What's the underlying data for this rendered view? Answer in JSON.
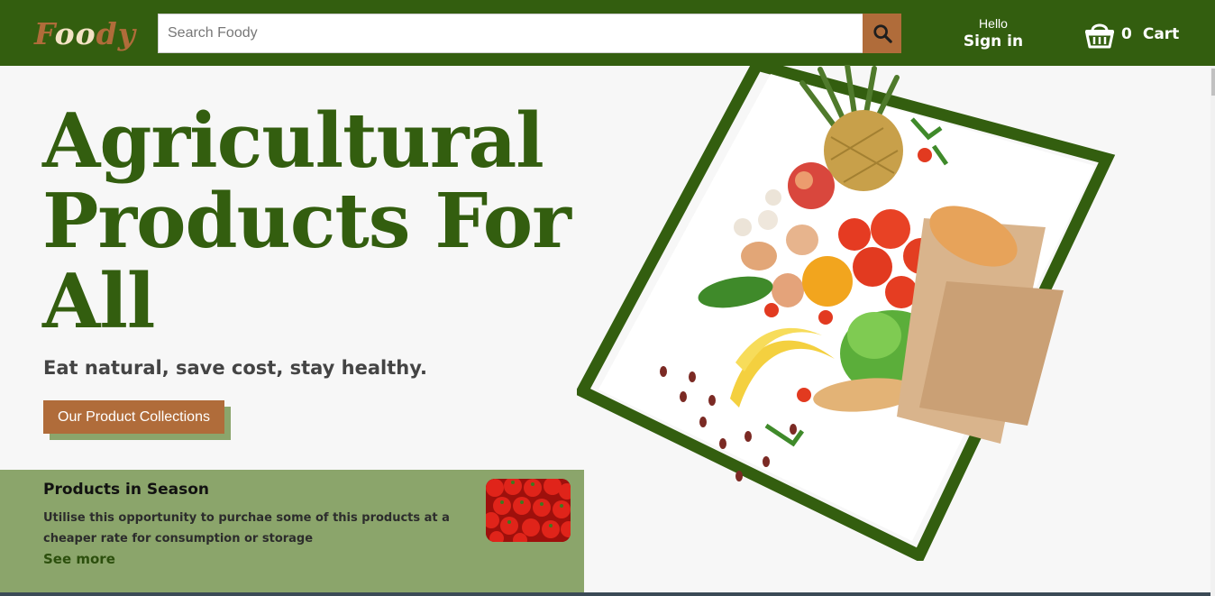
{
  "header": {
    "logo": {
      "part1": "F",
      "part2": "oo",
      "part3": "dy"
    },
    "search_placeholder": "Search Foody",
    "signin_greeting": "Hello",
    "signin_label": "Sign in",
    "cart_count": "0",
    "cart_label": "Cart"
  },
  "hero": {
    "title_line1": "Agricultural",
    "title_line2": "Products For",
    "title_line3": "All",
    "tagline": "Eat natural, save cost, stay healthy.",
    "cta_label": "Our Product Collections"
  },
  "season": {
    "title": "Products in Season",
    "text": "Utilise this opportunity to purchae some of this products at a cheaper rate for consumption or storage",
    "link": "See more"
  },
  "colors": {
    "brand_green": "#335e0f",
    "accent_brown": "#b06c3a",
    "panel_green": "#8ba56b"
  },
  "icons": {
    "search": "search-icon",
    "cart": "shopping-basket-icon"
  }
}
